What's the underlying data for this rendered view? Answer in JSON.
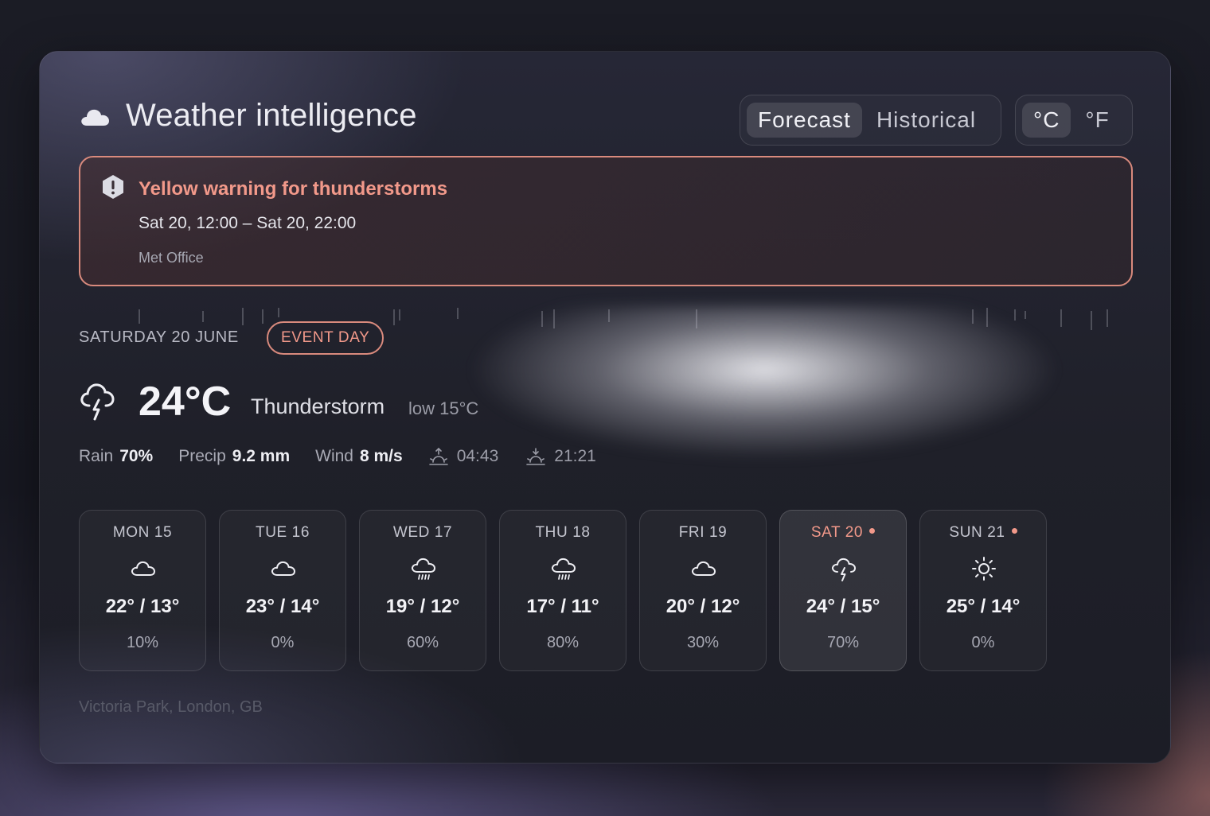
{
  "header": {
    "title": "Weather intelligence",
    "icon": "cloud-icon"
  },
  "mode": {
    "options": [
      "Forecast",
      "Historical"
    ],
    "selected": "Forecast"
  },
  "units": {
    "options": [
      "°C",
      "°F"
    ],
    "selected": "°C"
  },
  "alert": {
    "title": "Yellow warning for thunderstorms",
    "time": "Sat 20, 12:00 – Sat 20, 22:00",
    "source": "Met Office",
    "color": "#f2998a"
  },
  "today": {
    "date": "SATURDAY 20 JUNE",
    "badge": "EVENT DAY",
    "icon": "thunderstorm-icon",
    "temp": "24°C",
    "condition": "Thunderstorm",
    "low": "low 15°C",
    "rain_label": "Rain",
    "rain": "70%",
    "precip_label": "Precip",
    "precip": "9.2 mm",
    "wind_label": "Wind",
    "wind": "8 m/s",
    "sunrise": "04:43",
    "sunset": "21:21"
  },
  "days": [
    {
      "name": "MON 15",
      "icon": "cloud-icon",
      "temps": "22° / 13°",
      "pop": "10%"
    },
    {
      "name": "TUE 16",
      "icon": "cloud-icon",
      "temps": "23° / 14°",
      "pop": "0%"
    },
    {
      "name": "WED 17",
      "icon": "rain-icon",
      "temps": "19° / 12°",
      "pop": "60%"
    },
    {
      "name": "THU 18",
      "icon": "rain-icon",
      "temps": "17° / 11°",
      "pop": "80%"
    },
    {
      "name": "FRI 19",
      "icon": "cloud-icon",
      "temps": "20° / 12°",
      "pop": "30%"
    },
    {
      "name": "SAT 20",
      "icon": "thunderstorm-icon",
      "temps": "24° / 15°",
      "pop": "70%"
    },
    {
      "name": "SUN 21",
      "icon": "sun-icon",
      "temps": "25° / 14°",
      "pop": "0%"
    }
  ],
  "location": "Victoria Park, London, GB"
}
